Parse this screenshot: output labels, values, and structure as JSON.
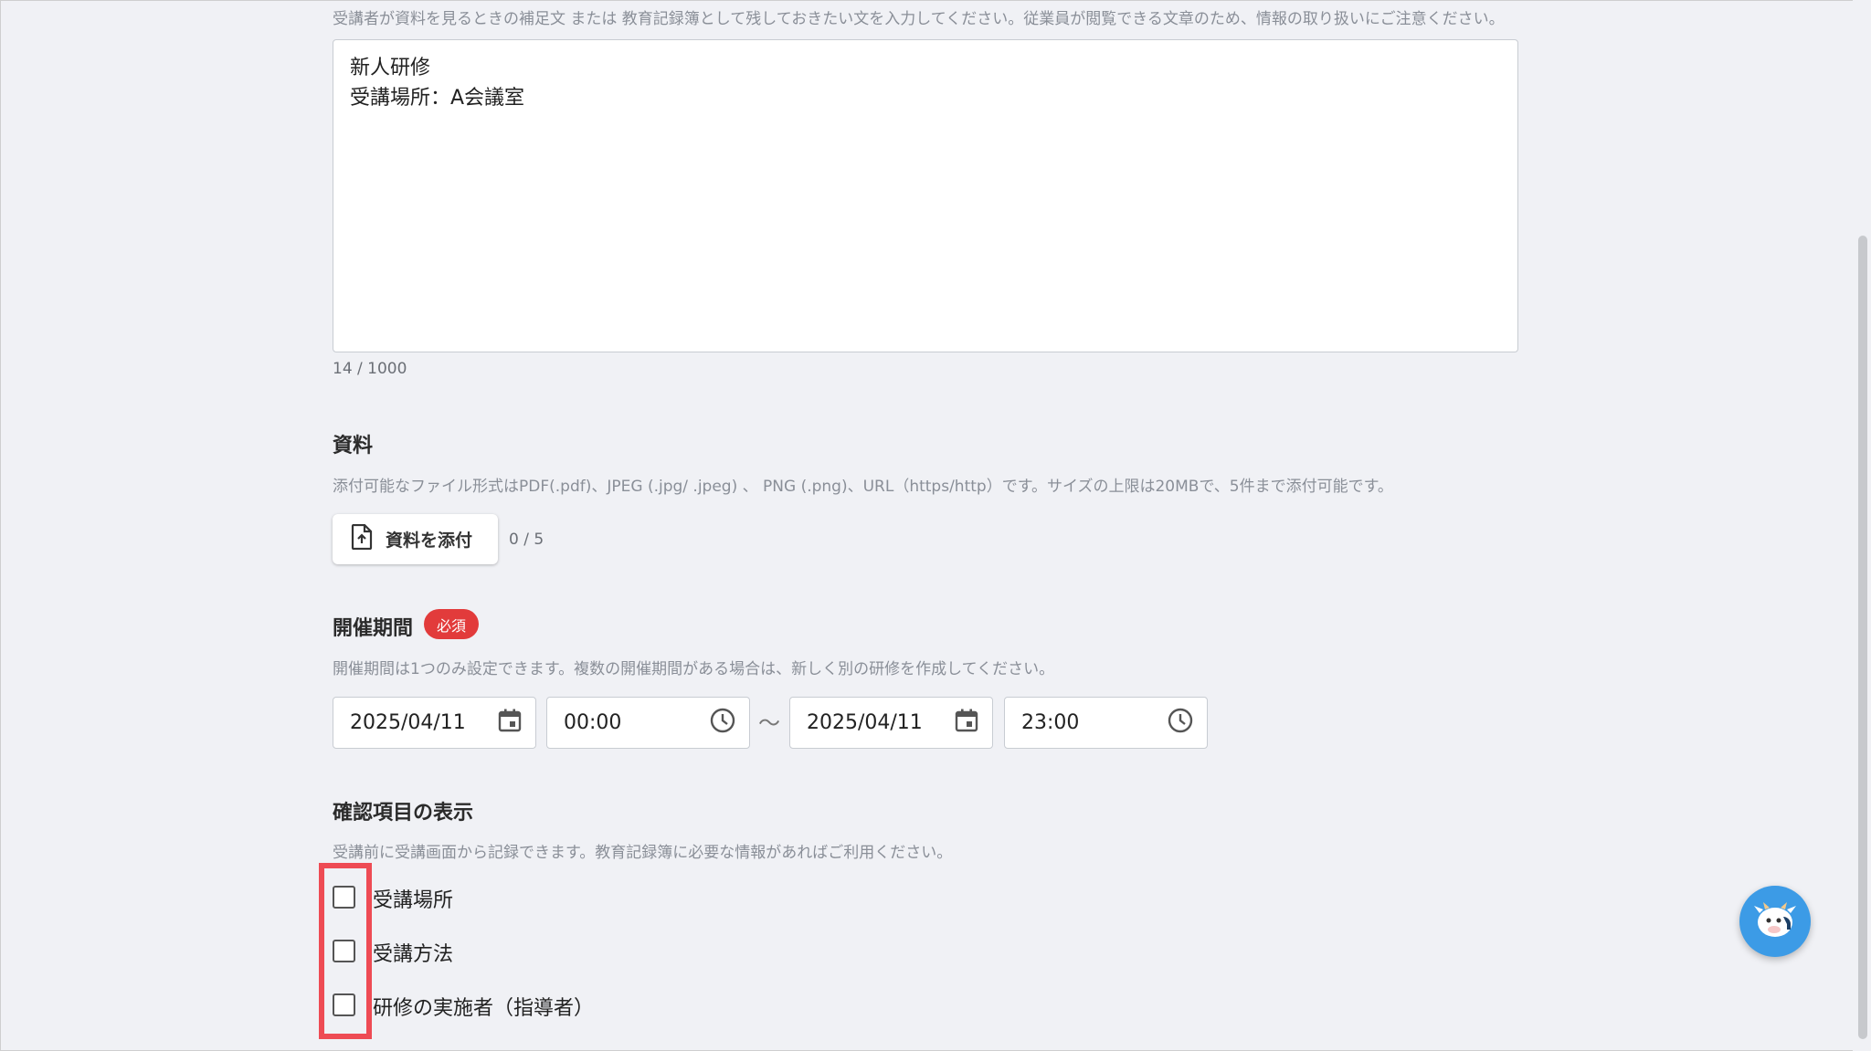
{
  "memo": {
    "hint": "受講者が資料を見るときの補足文 または 教育記録簿として残しておきたい文を入力してください。従業員が閲覧できる文章のため、情報の取り扱いにご注意ください。",
    "line1": "新人研修",
    "line2": "受講場所：A会議室",
    "counter": "14 / 1000"
  },
  "materials": {
    "title": "資料",
    "hint": "添付可能なファイル形式はPDF(.pdf)、JPEG (.jpg/ .jpeg) 、 PNG (.png)、URL（https/http）です。サイズの上限は20MBで、5件まで添付可能です。",
    "attach_label": "資料を添付",
    "count": "0 / 5"
  },
  "period": {
    "title": "開催期間",
    "required_badge": "必須",
    "hint": "開催期間は1つのみ設定できます。複数の開催期間がある場合は、新しく別の研修を作成してください。",
    "start_date": "2025/04/11",
    "start_time": "00:00",
    "separator": "〜",
    "end_date": "2025/04/11",
    "end_time": "23:00"
  },
  "confirm": {
    "title": "確認項目の表示",
    "hint": "受講前に受講画面から記録できます。教育記録簿に必要な情報があればご利用ください。",
    "items": [
      {
        "label": "受講場所",
        "checked": false
      },
      {
        "label": "受講方法",
        "checked": false
      },
      {
        "label": "研修の実施者（指導者）",
        "checked": false
      }
    ]
  },
  "colors": {
    "required": "#e23b3b",
    "highlight": "#ee4b54",
    "chat": "#3c9be6"
  }
}
